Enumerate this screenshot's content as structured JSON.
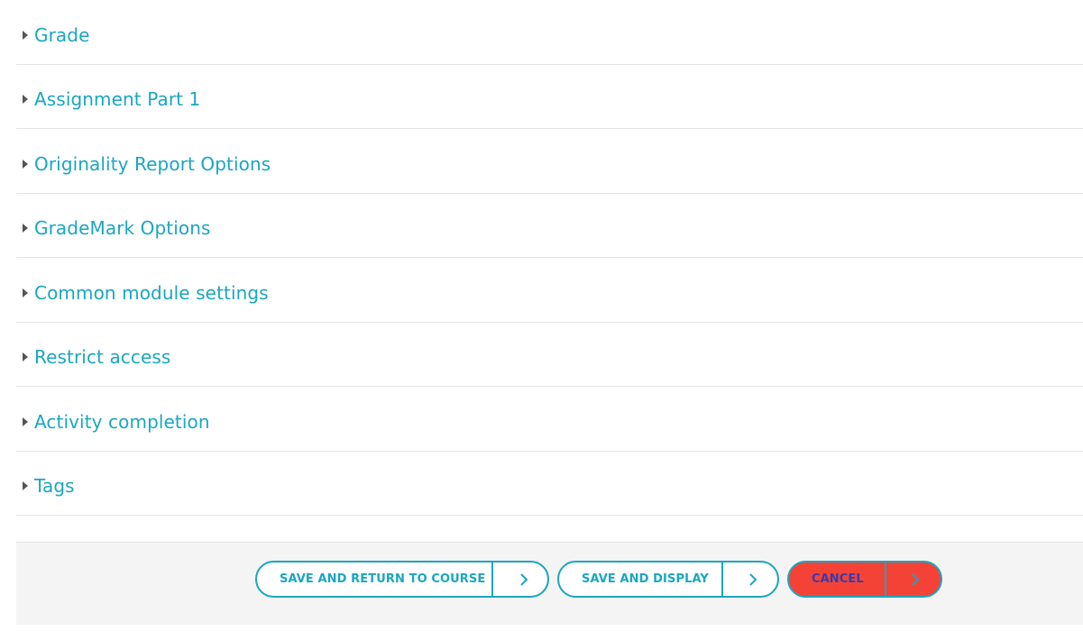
{
  "sections": [
    {
      "title": "Grade"
    },
    {
      "title": "Assignment Part 1"
    },
    {
      "title": "Originality Report Options"
    },
    {
      "title": "GradeMark Options"
    },
    {
      "title": "Common module settings"
    },
    {
      "title": "Restrict access"
    },
    {
      "title": "Activity completion"
    },
    {
      "title": "Tags"
    }
  ],
  "footer": {
    "save_return_label": "SAVE AND RETURN TO COURSE",
    "save_display_label": "SAVE AND DISPLAY",
    "cancel_label": "CANCEL"
  },
  "icons": {
    "section_toggle": "caret-right-icon",
    "button_arrow": "chevron-right-icon"
  },
  "colors": {
    "accent": "#1aa6c1",
    "cancel_bg": "#f44336",
    "footer_bg": "#f4f4f4"
  }
}
